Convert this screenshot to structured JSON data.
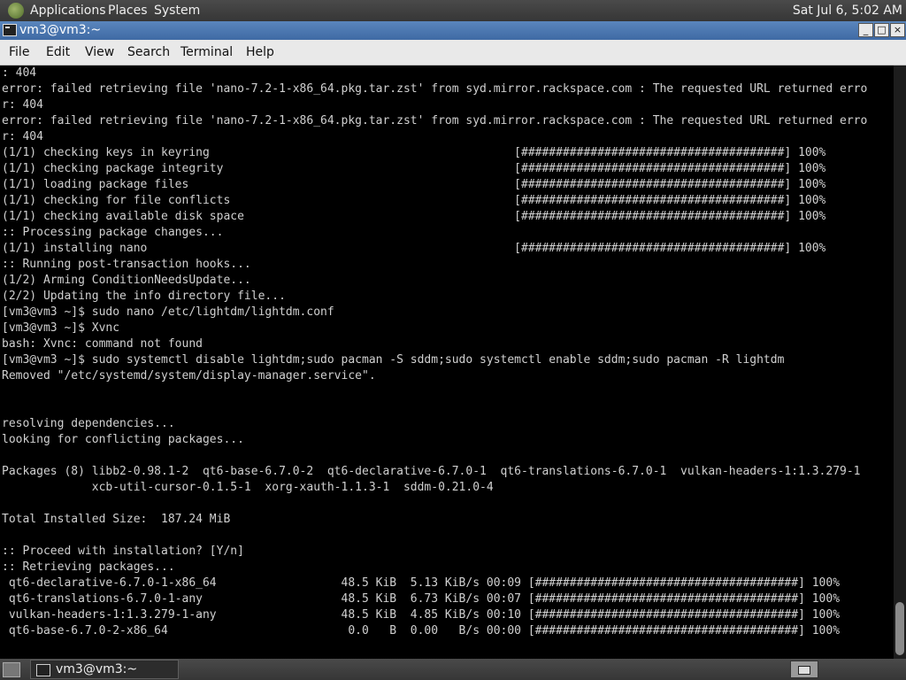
{
  "top_panel": {
    "menus": [
      "Applications",
      "Places",
      "System"
    ],
    "clock": "Sat Jul  6,  5:02 AM",
    "apps_icon": "gnome-foot-icon"
  },
  "window": {
    "title": "vm3@vm3:~",
    "controls": {
      "minimize": "_",
      "maximize": "□",
      "close": "×"
    },
    "menus": [
      "File",
      "Edit",
      "View",
      "Search",
      "Terminal",
      "Help"
    ]
  },
  "terminal": {
    "lines": [
      ": 404",
      "error: failed retrieving file 'nano-7.2-1-x86_64.pkg.tar.zst' from syd.mirror.rackspace.com : The requested URL returned erro",
      "r: 404",
      "error: failed retrieving file 'nano-7.2-1-x86_64.pkg.tar.zst' from syd.mirror.rackspace.com : The requested URL returned erro",
      "r: 404",
      "(1/1) checking keys in keyring                                            [######################################] 100%",
      "(1/1) checking package integrity                                          [######################################] 100%",
      "(1/1) loading package files                                               [######################################] 100%",
      "(1/1) checking for file conflicts                                         [######################################] 100%",
      "(1/1) checking available disk space                                       [######################################] 100%",
      ":: Processing package changes...",
      "(1/1) installing nano                                                     [######################################] 100%",
      ":: Running post-transaction hooks...",
      "(1/2) Arming ConditionNeedsUpdate...",
      "(2/2) Updating the info directory file...",
      "[vm3@vm3 ~]$ sudo nano /etc/lightdm/lightdm.conf",
      "[vm3@vm3 ~]$ Xvnc",
      "bash: Xvnc: command not found",
      "[vm3@vm3 ~]$ sudo systemctl disable lightdm;sudo pacman -S sddm;sudo systemctl enable sddm;sudo pacman -R lightdm",
      "Removed \"/etc/systemd/system/display-manager.service\".",
      "",
      "",
      "resolving dependencies...",
      "looking for conflicting packages...",
      "",
      "Packages (8) libb2-0.98.1-2  qt6-base-6.7.0-2  qt6-declarative-6.7.0-1  qt6-translations-6.7.0-1  vulkan-headers-1:1.3.279-1",
      "             xcb-util-cursor-0.1.5-1  xorg-xauth-1.1.3-1  sddm-0.21.0-4",
      "",
      "Total Installed Size:  187.24 MiB",
      "",
      ":: Proceed with installation? [Y/n]",
      ":: Retrieving packages...",
      " qt6-declarative-6.7.0-1-x86_64                  48.5 KiB  5.13 KiB/s 00:09 [######################################] 100%",
      " qt6-translations-6.7.0-1-any                    48.5 KiB  6.73 KiB/s 00:07 [######################################] 100%",
      " vulkan-headers-1:1.3.279-1-any                  48.5 KiB  4.85 KiB/s 00:10 [######################################] 100%",
      " qt6-base-6.7.0-2-x86_64                          0.0   B  0.00   B/s 00:00 [######################################] 100%"
    ]
  },
  "bottom_panel": {
    "task_label": "vm3@vm3:~",
    "desktop_icon": "show-desktop-icon",
    "workspace_icon": "workspace-switcher-icon"
  }
}
